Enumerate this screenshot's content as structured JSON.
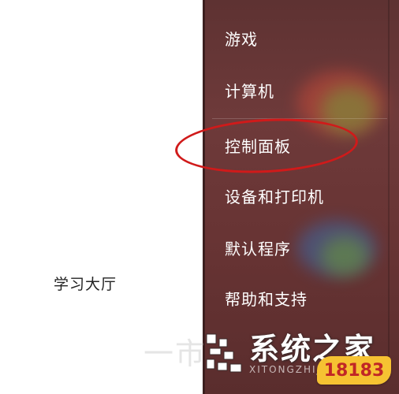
{
  "left_panel": {
    "label": "学习大厅"
  },
  "start_menu": {
    "items": [
      {
        "label": "游戏"
      },
      {
        "label": "计算机"
      },
      {
        "label": "控制面板"
      },
      {
        "label": "设备和打印机"
      },
      {
        "label": "默认程序"
      },
      {
        "label": "帮助和支持"
      }
    ],
    "highlighted_item": "控制面板",
    "highlight_color": "#d01a1a"
  },
  "watermark": {
    "ghost_text": "一市",
    "text": "系统之家",
    "subtext": "XITONGZHIJIA",
    "badge": "18183"
  },
  "colors": {
    "menu_background": "#6a3636",
    "badge_background": "#f6c232",
    "badge_text": "#c02626"
  }
}
